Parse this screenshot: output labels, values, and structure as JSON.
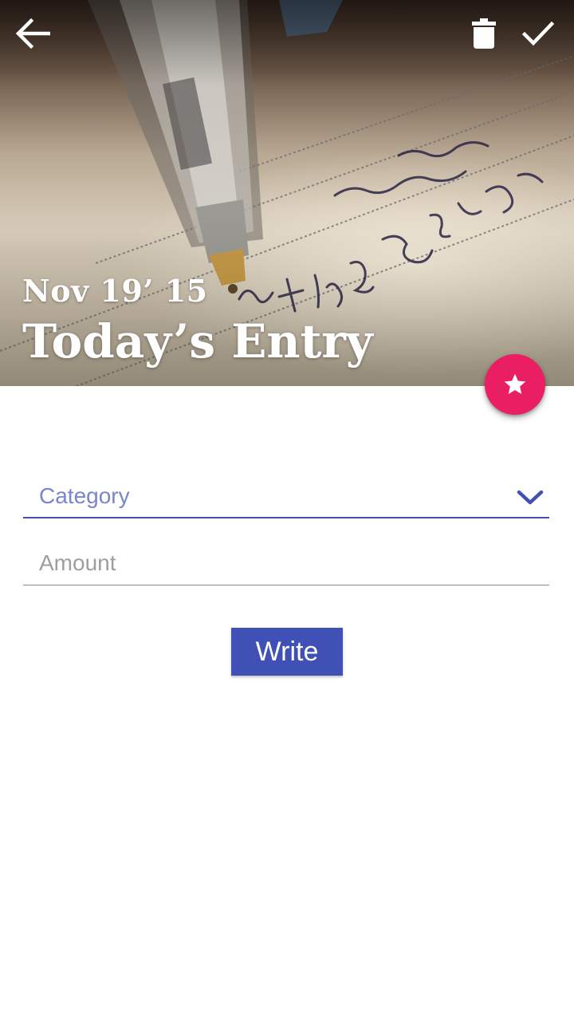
{
  "header": {
    "date": "Nov 19’ 15",
    "title": "Today’s Entry",
    "photo": "pen-writing-on-paper"
  },
  "toolbar": {
    "back_icon": "arrow-back-icon",
    "delete_icon": "trash-icon",
    "confirm_icon": "check-icon"
  },
  "fab": {
    "icon": "star-icon",
    "color": "#e91e63"
  },
  "form": {
    "category": {
      "label": "Category",
      "icon": "chevron-down-icon"
    },
    "amount": {
      "placeholder": "Amount",
      "value": ""
    },
    "submit_label": "Write"
  },
  "colors": {
    "primary": "#3f51b5",
    "accent": "#e91e63",
    "category_text": "#7986cb"
  }
}
